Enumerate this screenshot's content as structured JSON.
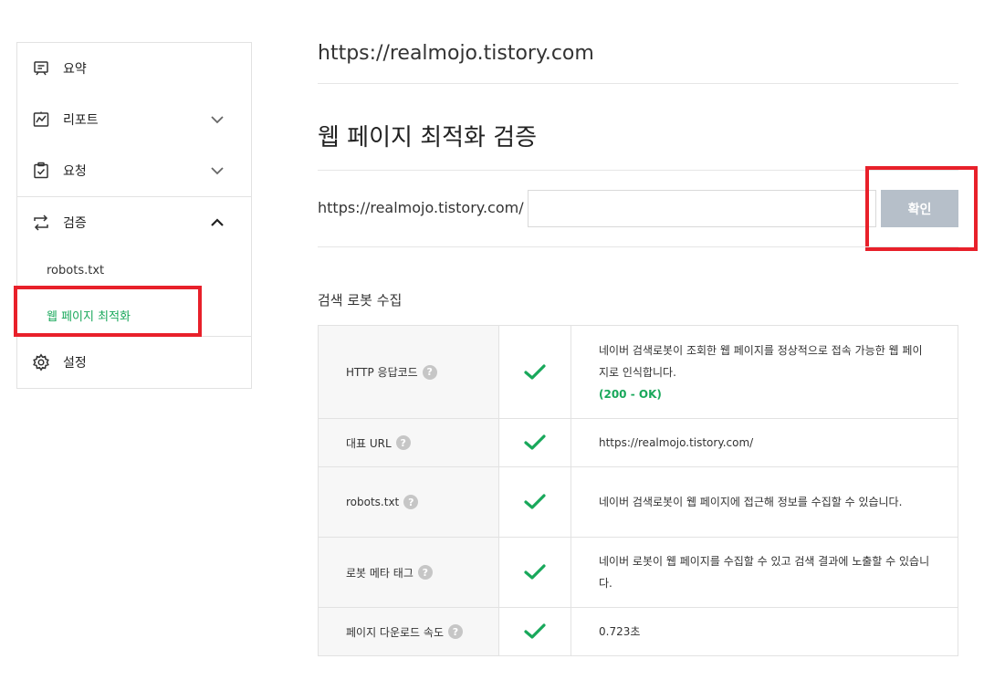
{
  "sidebar": {
    "items": [
      {
        "label": "요약",
        "icon": "summary-icon"
      },
      {
        "label": "리포트",
        "icon": "report-icon"
      },
      {
        "label": "요청",
        "icon": "request-icon"
      },
      {
        "label": "검증",
        "icon": "verify-icon"
      },
      {
        "label": "설정",
        "icon": "settings-icon"
      }
    ],
    "sub_items": [
      "robots.txt",
      "웹 페이지 최적화"
    ]
  },
  "main": {
    "site_url": "https://realmojo.tistory.com",
    "title": "웹 페이지 최적화 검증",
    "url_prefix": "https://realmojo.tistory.com/",
    "input_value": "",
    "confirm_label": "확인",
    "section_title": "검색 로봇 수집",
    "help_glyph": "?"
  },
  "results": [
    {
      "label": "HTTP 응답코드",
      "desc": "네이버 검색로봇이 조회한 웹 페이지를 정상적으로 접속 가능한 웹 페이지로 인식합니다.",
      "status": "(200 - OK)"
    },
    {
      "label": "대표 URL",
      "desc": "https://realmojo.tistory.com/"
    },
    {
      "label": "robots.txt",
      "desc": "네이버 검색로봇이 웹 페이지에 접근해 정보를 수집할 수 있습니다."
    },
    {
      "label": "로봇 메타 태그",
      "desc": "네이버 로봇이 웹 페이지를 수집할 수 있고 검색 결과에 노출할 수 있습니다."
    },
    {
      "label": "페이지 다운로드 속도",
      "desc": "0.723초"
    }
  ],
  "colors": {
    "accent": "#19a85b",
    "highlight": "#e8202a",
    "button": "#b6bfc9"
  }
}
